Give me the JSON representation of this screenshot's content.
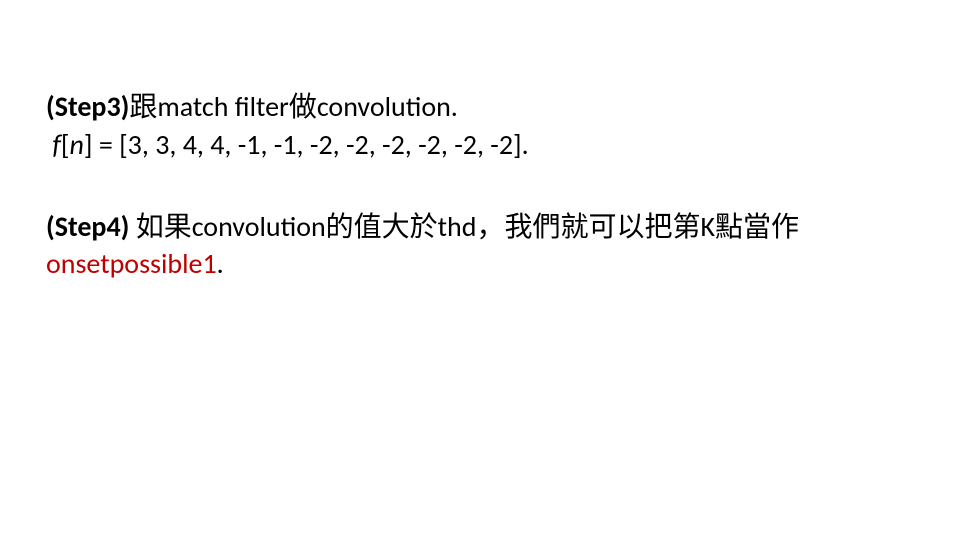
{
  "step3": {
    "label": "(Step3)",
    "text_after": "跟match filter做convolution.",
    "fn_f": "f",
    "fn_bracket_open": "[",
    "fn_n": "n",
    "fn_bracket_close": "]",
    "fn_equals": " =  ",
    "fn_values": "[3, 3, 4, 4, -1, -1, -2, -2, -2, -2, -2, -2]."
  },
  "step4": {
    "label": "(Step4)",
    "text_before_red": " 如果convolution的值大於thd，我們就可以把第K點當作",
    "red_text": "onsetpossible1",
    "period": "."
  }
}
